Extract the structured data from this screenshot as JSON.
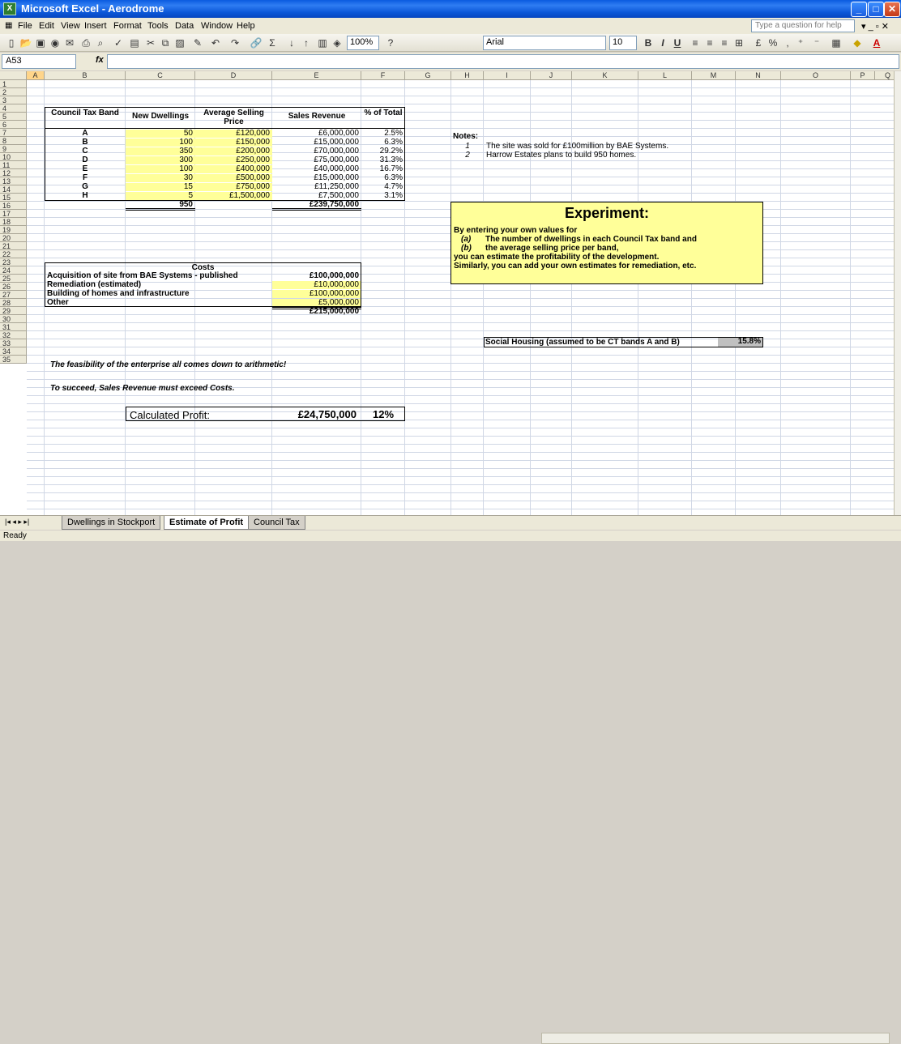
{
  "window": {
    "title": "Microsoft Excel - Aerodrome"
  },
  "menu": [
    "File",
    "Edit",
    "View",
    "Insert",
    "Format",
    "Tools",
    "Data",
    "Window",
    "Help"
  ],
  "help_placeholder": "Type a question for help",
  "toolbar": {
    "zoom": "100%",
    "font": "Arial",
    "size": "10"
  },
  "formula_bar": {
    "name_box": "A53",
    "fx": "fx",
    "value": ""
  },
  "columns": [
    "A",
    "B",
    "C",
    "D",
    "E",
    "F",
    "G",
    "H",
    "I",
    "J",
    "K",
    "L",
    "M",
    "N",
    "O",
    "P",
    "Q"
  ],
  "rows": [
    "1",
    "2",
    "3",
    "4",
    "5",
    "6",
    "7",
    "8",
    "9",
    "10",
    "11",
    "12",
    "13",
    "14",
    "15",
    "16",
    "17",
    "18",
    "19",
    "20",
    "21",
    "22",
    "23",
    "24",
    "25",
    "26",
    "27",
    "28",
    "29",
    "30",
    "31",
    "32",
    "33",
    "34",
    "35"
  ],
  "dwellings": {
    "headers": {
      "band": "Council Tax Band",
      "new_dwellings": "New Dwellings",
      "avg_price": "Average Selling Price",
      "revenue": "Sales Revenue",
      "pct": "% of Total"
    },
    "rows": [
      {
        "band": "A",
        "new": "50",
        "price": "£120,000",
        "revenue": "£6,000,000",
        "pct": "2.5%"
      },
      {
        "band": "B",
        "new": "100",
        "price": "£150,000",
        "revenue": "£15,000,000",
        "pct": "6.3%"
      },
      {
        "band": "C",
        "new": "350",
        "price": "£200,000",
        "revenue": "£70,000,000",
        "pct": "29.2%"
      },
      {
        "band": "D",
        "new": "300",
        "price": "£250,000",
        "revenue": "£75,000,000",
        "pct": "31.3%"
      },
      {
        "band": "E",
        "new": "100",
        "price": "£400,000",
        "revenue": "£40,000,000",
        "pct": "16.7%"
      },
      {
        "band": "F",
        "new": "30",
        "price": "£500,000",
        "revenue": "£15,000,000",
        "pct": "6.3%"
      },
      {
        "band": "G",
        "new": "15",
        "price": "£750,000",
        "revenue": "£11,250,000",
        "pct": "4.7%"
      },
      {
        "band": "H",
        "new": "5",
        "price": "£1,500,000",
        "revenue": "£7,500,000",
        "pct": "3.1%"
      }
    ],
    "total_new": "950",
    "total_revenue": "£239,750,000"
  },
  "costs": {
    "header": "Costs",
    "items": [
      {
        "label": "Acquisition of site from BAE Systems - published",
        "value": "£100,000,000"
      },
      {
        "label": "Remediation (estimated)",
        "value": "£10,000,000"
      },
      {
        "label": "Building of homes and infrastructure",
        "value": "£100,000,000"
      },
      {
        "label": "Other",
        "value": "£5,000,000"
      }
    ],
    "total": "£215,000,000"
  },
  "notes": {
    "title": "Notes:",
    "items": [
      {
        "num": "1",
        "text": "The site was sold for £100million by BAE Systems."
      },
      {
        "num": "2",
        "text": "Harrow Estates plans to build 950 homes."
      }
    ]
  },
  "experiment": {
    "title": "Experiment:",
    "line1": "By entering your own values for",
    "a_label": "(a)",
    "a_text": "The number of dwellings in each Council Tax band and",
    "b_label": "(b)",
    "b_text": "the average selling price per band,",
    "line4": "you can estimate the profitability of the development.",
    "line5": "Similarly, you can add your own estimates for remediation, etc."
  },
  "social_housing": {
    "label": "Social Housing (assumed to be CT bands A and B)",
    "value": "15.8%"
  },
  "text": {
    "feasibility": "The feasibility of the enterprise all comes down to arithmetic!",
    "succeed": "To succeed, Sales Revenue must exceed Costs."
  },
  "profit": {
    "label": "Calculated Profit:",
    "value": "£24,750,000",
    "pct": "12%"
  },
  "tabs": [
    "Dwellings in Stockport",
    "Estimate of Profit",
    "Council Tax"
  ],
  "status": "Ready"
}
